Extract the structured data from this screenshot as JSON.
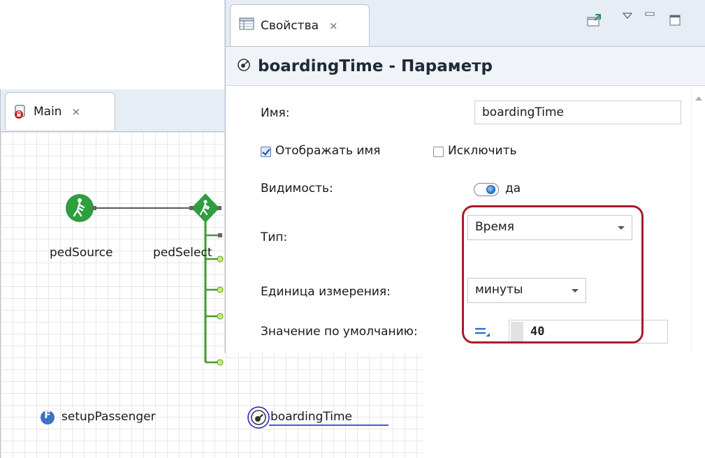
{
  "main_tab": {
    "title": "Main",
    "close": "⨯"
  },
  "canvas": {
    "blocks": [
      {
        "label": "pedSource",
        "icon": "pedestrian-source-icon"
      },
      {
        "label": "pedSelect",
        "icon": "pedestrian-select-icon"
      }
    ],
    "function_label": "setupPassenger",
    "function_badge": "F",
    "parameter_label": "boardingTime"
  },
  "properties_tab": {
    "title": "Свойства",
    "close": "⨯"
  },
  "properties": {
    "header_title": "boardingTime - Параметр",
    "name_label": "Имя:",
    "name_value": "boardingTime",
    "show_name_label": "Отображать имя",
    "show_name_checked": true,
    "exclude_label": "Исключить",
    "exclude_checked": false,
    "visibility_label": "Видимость:",
    "visibility_value": "да",
    "type_label": "Тип:",
    "type_value": "Время",
    "unit_label": "Единица измерения:",
    "unit_value": "минуты",
    "default_label": "Значение по умолчанию:",
    "default_value": "40"
  },
  "colors": {
    "tab_bar": "#e6edf5",
    "ped_green": "#2e9e3e",
    "connector_green": "#3f9b2e",
    "highlight_red": "#a71d2a",
    "param_underline": "#1a1acc"
  }
}
